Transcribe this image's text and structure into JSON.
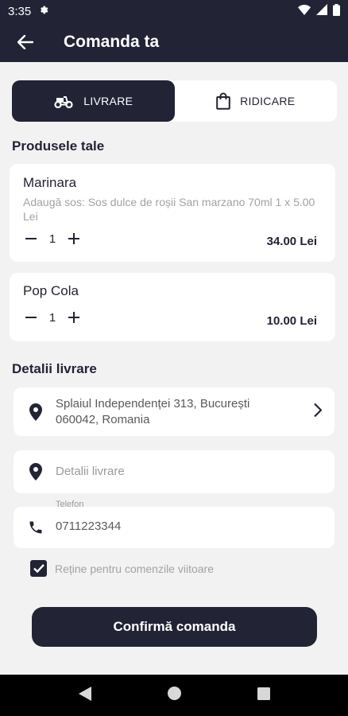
{
  "status_bar": {
    "time": "3:35"
  },
  "header": {
    "title": "Comanda ta"
  },
  "delivery_toggle": {
    "options": [
      {
        "label": "LIVRARE",
        "icon": "scooter-icon",
        "active": true
      },
      {
        "label": "RIDICARE",
        "icon": "shopping-bag-icon",
        "active": false
      }
    ]
  },
  "products_section": {
    "title": "Produsele tale",
    "items": [
      {
        "name": "Marinara",
        "note": "Adaugă sos: Sos dulce de roșii San marzano 70ml 1 x 5.00 Lei",
        "quantity": "1",
        "price": "34.00 Lei"
      },
      {
        "name": "Pop Cola",
        "note": "",
        "quantity": "1",
        "price": "10.00 Lei"
      }
    ]
  },
  "delivery_details": {
    "title": "Detalii livrare",
    "address_line1": "Splaiul Independenței 313, București",
    "address_line2": "060042, Romania",
    "details_placeholder": "Detalii livrare",
    "phone_label": "Telefon",
    "phone_value": "0711223344"
  },
  "remember": {
    "label": "Reține pentru comenzile viitoare",
    "checked": true
  },
  "confirm_button": {
    "label": "Confirmă comanda"
  },
  "colors": {
    "primary": "#232336",
    "background": "#f2f2f2",
    "muted": "#a2a2a2"
  }
}
